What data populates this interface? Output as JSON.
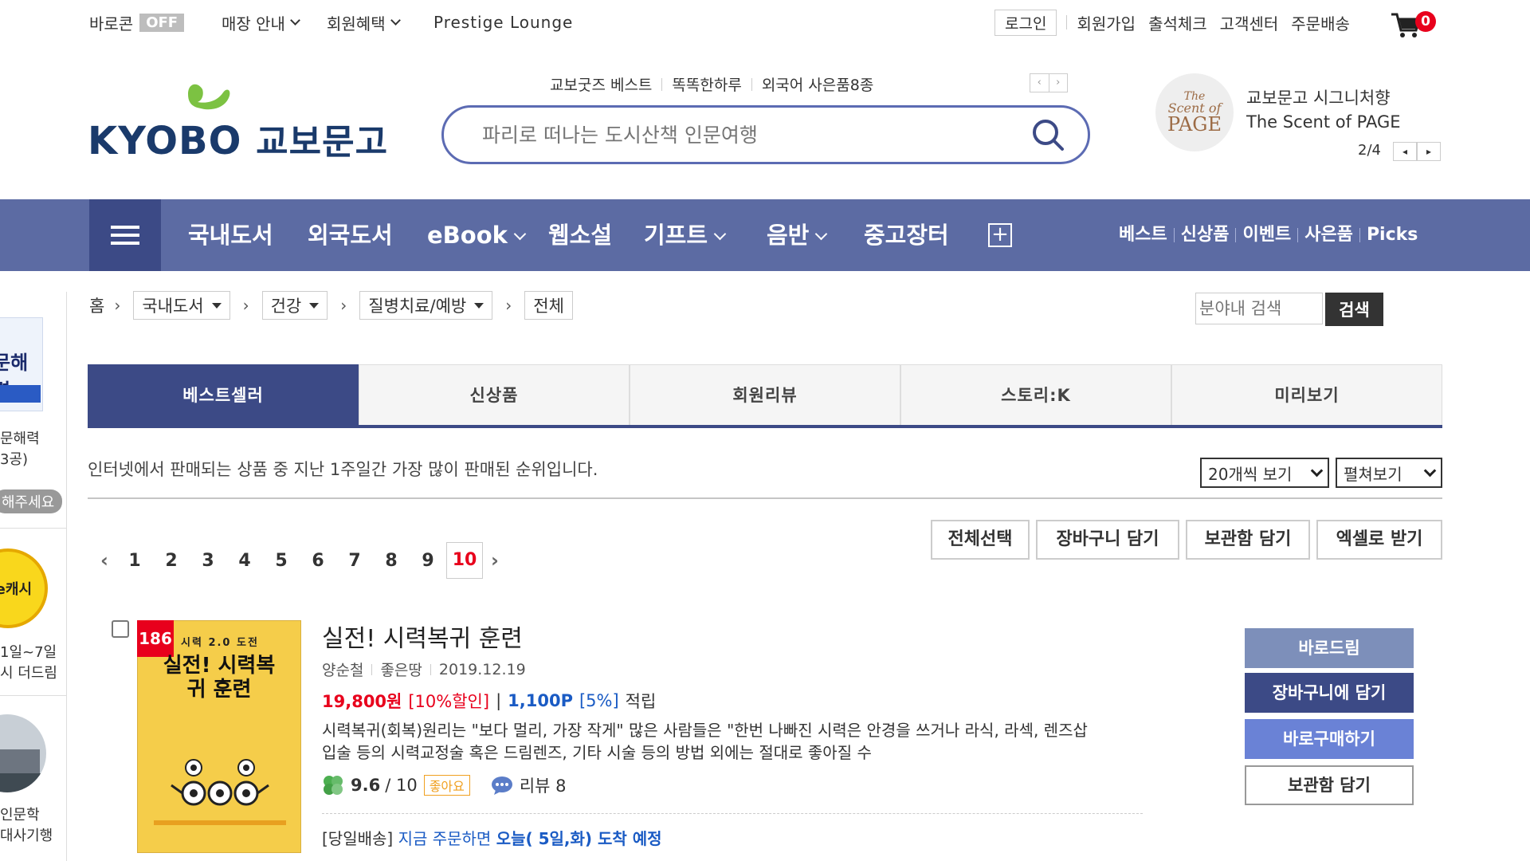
{
  "top_bar": {
    "barocon": "바로콘",
    "barocon_state": "OFF",
    "store_info": "매장 안내",
    "member_benefits": "회원혜택",
    "prestige": "Prestige Lounge",
    "login": "로그인",
    "signup": "회원가입",
    "attendance": "출석체크",
    "customer_center": "고객센터",
    "order_delivery": "주문배송",
    "cart_count": "0"
  },
  "logo": {
    "brand_en": "KYOBO",
    "brand_ko": "교보문고"
  },
  "search": {
    "keywords": [
      "교보굿즈 베스트",
      "똑똑한하루",
      "외국어 사은품8종"
    ],
    "placeholder": "파리로 떠나는 도시산책 인문여행"
  },
  "ad": {
    "circle_line1": "The",
    "circle_line2": "Scent of",
    "circle_line3": "PAGE",
    "title": "교보문고 시그니처향",
    "subtitle": "The Scent of PAGE",
    "pager": "2/4"
  },
  "gnb": {
    "items": [
      "국내도서",
      "외국도서",
      "eBook",
      "웹소설",
      "기프트",
      "음반",
      "중고장터"
    ],
    "right": [
      "베스트",
      "신상품",
      "이벤트",
      "사은품",
      "Picks"
    ]
  },
  "sidebar": {
    "book_label": "문해력",
    "line1": "문해력",
    "line2": "3공)",
    "pill": "해주세요",
    "ecash": "e캐시",
    "event_line1": "1일~7일",
    "event_line2": "시 더드림",
    "lit_line1": "인문학",
    "lit_line2": "대사기행"
  },
  "breadcrumb": {
    "home": "홈",
    "level1": "국내도서",
    "level2": "건강",
    "level3": "질병치료/예방",
    "level4": "전체",
    "search_placeholder": "분야내 검색",
    "search_button": "검색"
  },
  "tabs": [
    "베스트셀러",
    "신상품",
    "회원리뷰",
    "스토리:K",
    "미리보기"
  ],
  "description": "인터넷에서 판매되는 상품 중 지난 1주일간 가장 많이 판매된 순위입니다.",
  "view_count": "20개씩 보기",
  "view_mode": "펼쳐보기",
  "actions": [
    "전체선택",
    "장바구니 담기",
    "보관함 담기",
    "엑셀로 받기"
  ],
  "pagination": {
    "pages": [
      "1",
      "2",
      "3",
      "4",
      "5",
      "6",
      "7",
      "8",
      "9",
      "10"
    ],
    "current": "10"
  },
  "product": {
    "rank": "186",
    "cover_top": "시력 2.0 도전",
    "cover_title": "실전! 시력복귀 훈련",
    "title": "실전! 시력복귀 훈련",
    "author": "양순철",
    "publisher": "좋은땅",
    "date": "2019.12.19",
    "price": "19,800원",
    "discount": "[10%할인]",
    "point_sep": "|",
    "point": "1,100P",
    "point_rate": "[5%]",
    "point_label": "적립",
    "summary_line1": "시력복귀(회복)원리는 \"보다 멀리, 가장 작게\" 많은 사람들은 \"한번 나빠진 시력은 안경을 쓰거나 라식, 라섹, 렌즈삽",
    "summary_line2": "입술 등의 시력교정술 혹은 드림렌즈, 기타 시술 등의 방법 외에는 절대로 좋아질 수",
    "rating": "9.6",
    "rating_max": "/ 10",
    "like_badge": "좋아요",
    "review": "리뷰 8",
    "delivery_prefix": "[당일배송]",
    "delivery_mid": "지금 주문하면",
    "delivery_bold": "오늘( 5일,화) 도착 예정",
    "buttons": [
      "바로드림",
      "장바구니에 담기",
      "바로구매하기",
      "보관함 담기"
    ]
  },
  "colors": {
    "gnb": "#5c6ba3",
    "gnb_dark": "#3c4a86",
    "accent_red": "#e8001c",
    "link_blue": "#1a5bc4"
  }
}
